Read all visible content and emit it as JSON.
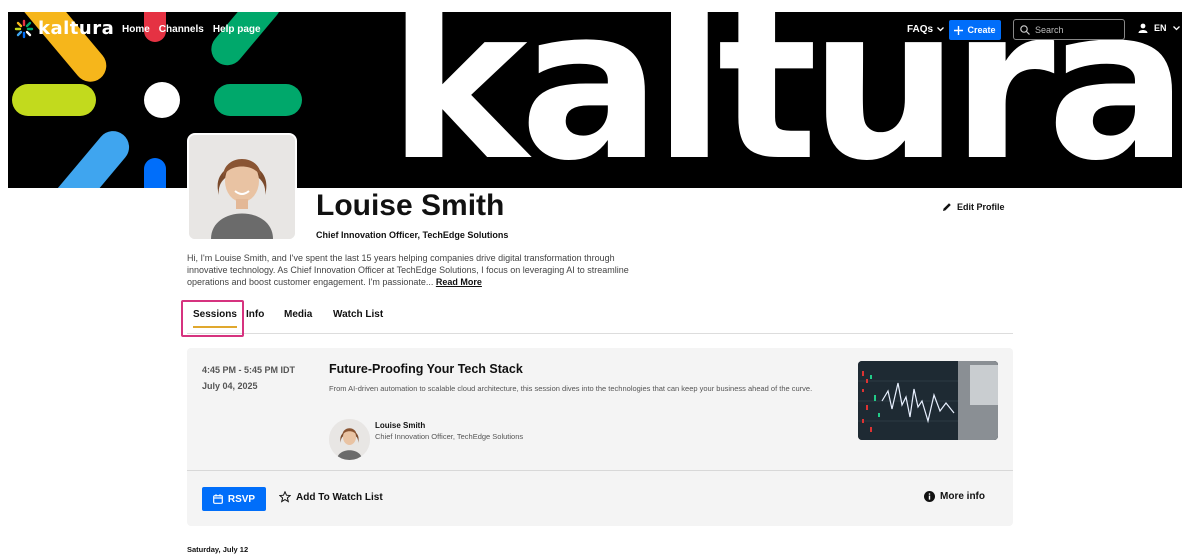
{
  "nav": {
    "logo_text": "kaltura",
    "links": [
      "Home",
      "Channels",
      "Help page"
    ],
    "faqs_label": "FAQs",
    "create_label": "Create",
    "search_placeholder": "Search",
    "lang_label": "EN"
  },
  "banner": {
    "wordmark": "kaltura"
  },
  "profile": {
    "name": "Louise Smith",
    "title": "Chief Innovation Officer, TechEdge Solutions",
    "bio": "Hi, I'm Louise Smith, and I've spent the last 15 years helping companies drive digital transformation through innovative technology. As Chief Innovation Officer at TechEdge Solutions, I focus on leveraging AI to streamline operations and boost customer engagement. I'm passionate...",
    "read_more_label": "Read More",
    "edit_profile_label": "Edit Profile"
  },
  "tabs": [
    {
      "label": "Sessions",
      "active": true
    },
    {
      "label": "Info",
      "active": false
    },
    {
      "label": "Media",
      "active": false
    },
    {
      "label": "Watch List",
      "active": false
    }
  ],
  "session": {
    "time": "4:45 PM - 5:45 PM IDT",
    "date": "July 04, 2025",
    "title": "Future-Proofing Your Tech Stack",
    "description": "From AI-driven automation to scalable cloud architecture, this session dives into the technologies that can keep your business ahead of the curve.",
    "speaker_name": "Louise Smith",
    "speaker_title": "Chief Innovation Officer, TechEdge Solutions",
    "rsvp_label": "RSVP",
    "watchlist_label": "Add To Watch List",
    "more_info_label": "More info"
  },
  "next_date_label": "Saturday, July 12",
  "colors": {
    "accent_blue": "#006efa",
    "tab_underline": "#e0a82e",
    "highlight": "#d6337f",
    "banner_bg": "#000000"
  }
}
